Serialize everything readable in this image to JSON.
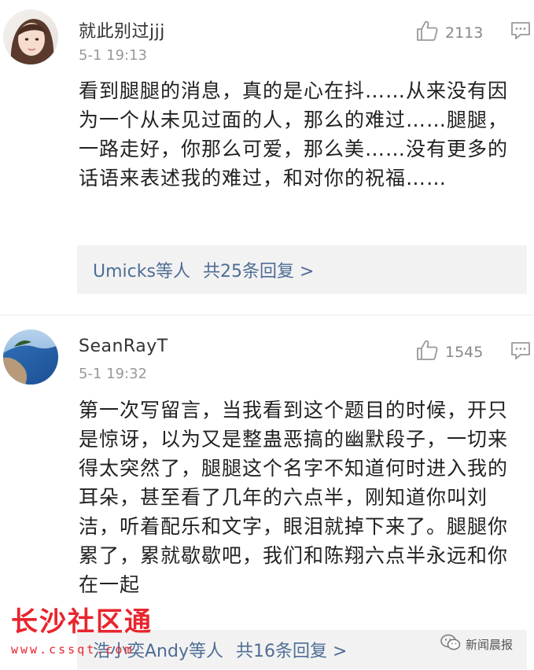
{
  "comments": [
    {
      "username": "就此别过jjj",
      "time": "5-1 19:13",
      "likes": "2113",
      "text": "看到腿腿的消息，真的是心在抖……从来没有因为一个从未见过面的人，那么的难过……腿腿，一路走好，你那么可爱，那么美……没有更多的话语来表述我的难过，和对你的祝福……",
      "reply_names": "Umicks等人",
      "reply_count": "共25条回复 >"
    },
    {
      "username": "SeanRayT",
      "time": "5-1 19:32",
      "likes": "1545",
      "text": "第一次写留言，当我看到这个题目的时候，开只是惊讶，以为又是整蛊恶搞的幽默段子，一切来得太突然了，腿腿这个名字不知道何时进入我的耳朵，甚至看了几年的六点半，刚知道你叫刘洁，听着配乐和文字，眼泪就掉下来了。腿腿你累了，累就歇歇吧，我们和陈翔六点半永远和你在一起",
      "reply_names": "浩小奕Andy等人",
      "reply_count": "共16条回复 >"
    }
  ],
  "watermarks": {
    "left_title": "长沙社区通",
    "left_url": "www.cssqt.com",
    "right_text": "新闻晨报"
  },
  "colors": {
    "link": "#4f6d95",
    "watermark_red": "#e8252d",
    "meta_gray": "#999999"
  },
  "icons": [
    "like-icon",
    "reply-icon",
    "wechat-icon"
  ]
}
